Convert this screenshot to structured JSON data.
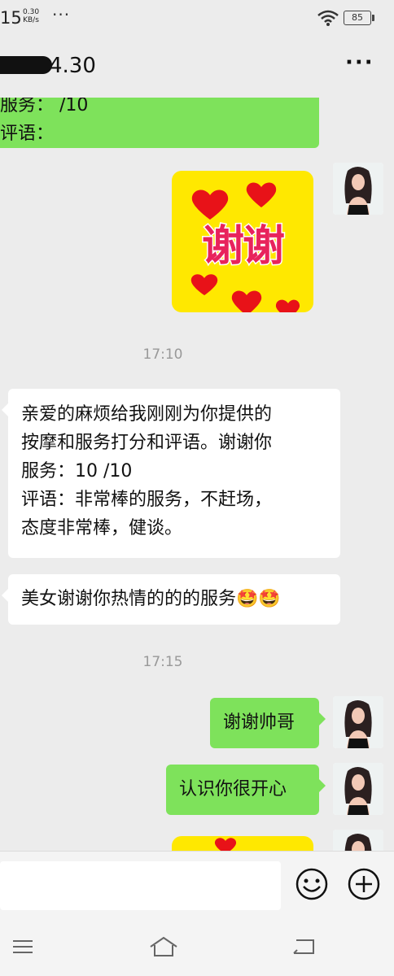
{
  "status": {
    "time": "15",
    "speed_value": "0.30",
    "speed_unit": "KB/s",
    "dots": "···",
    "battery": "85"
  },
  "header": {
    "title": "4.30",
    "more": "···"
  },
  "messages": {
    "top_partial": {
      "line1": "服务：  /10",
      "line2": "评语："
    },
    "sticker_text": "谢谢",
    "time1": "17:10",
    "review": {
      "line1": "亲爱的麻烦给我刚刚为你提供的",
      "line2": "按摩和服务打分和评语。谢谢你",
      "line3": "服务：10 /10",
      "line4": "评语：非常棒的服务，不赶场，",
      "line5": "态度非常棒，健谈。"
    },
    "thanks_beauty": "美女谢谢你热情的的的服务",
    "emoji": "🤩🤩",
    "time2": "17:15",
    "thanks_handsome": "谢谢帅哥",
    "nice_to_meet": "认识你很开心"
  },
  "colors": {
    "bubble_green": "#7ee25b",
    "sticker_yellow": "#ffe800",
    "sticker_text": "#e8235c",
    "heart": "#e81218"
  }
}
